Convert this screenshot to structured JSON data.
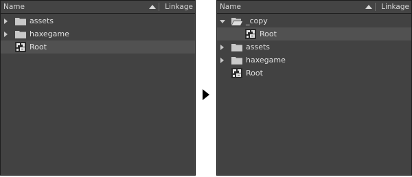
{
  "before_panel": {
    "header": {
      "name": "Name",
      "linkage": "Linkage"
    },
    "items": [
      {
        "label": "assets",
        "icon": "folder-icon",
        "expander": "collapsed"
      },
      {
        "label": "haxegame",
        "icon": "folder-icon",
        "expander": "collapsed"
      },
      {
        "label": "Root",
        "icon": "movieclip-symbol-icon",
        "selected": true
      }
    ]
  },
  "after_panel": {
    "header": {
      "name": "Name",
      "linkage": "Linkage"
    },
    "items": [
      {
        "label": "_copy",
        "icon": "open-folder-icon",
        "expander": "expanded"
      },
      {
        "label": "Root",
        "icon": "movieclip-symbol-icon",
        "selected": true,
        "nested": true
      },
      {
        "label": "assets",
        "icon": "folder-icon",
        "expander": "collapsed"
      },
      {
        "label": "haxegame",
        "icon": "folder-icon",
        "expander": "collapsed"
      },
      {
        "label": "Root",
        "icon": "movieclip-symbol-icon"
      }
    ]
  },
  "colors": {
    "panel_bg": "#424242",
    "selected_row": "#515151",
    "text": "#e0e0e0",
    "border": "#1e1e1e"
  }
}
